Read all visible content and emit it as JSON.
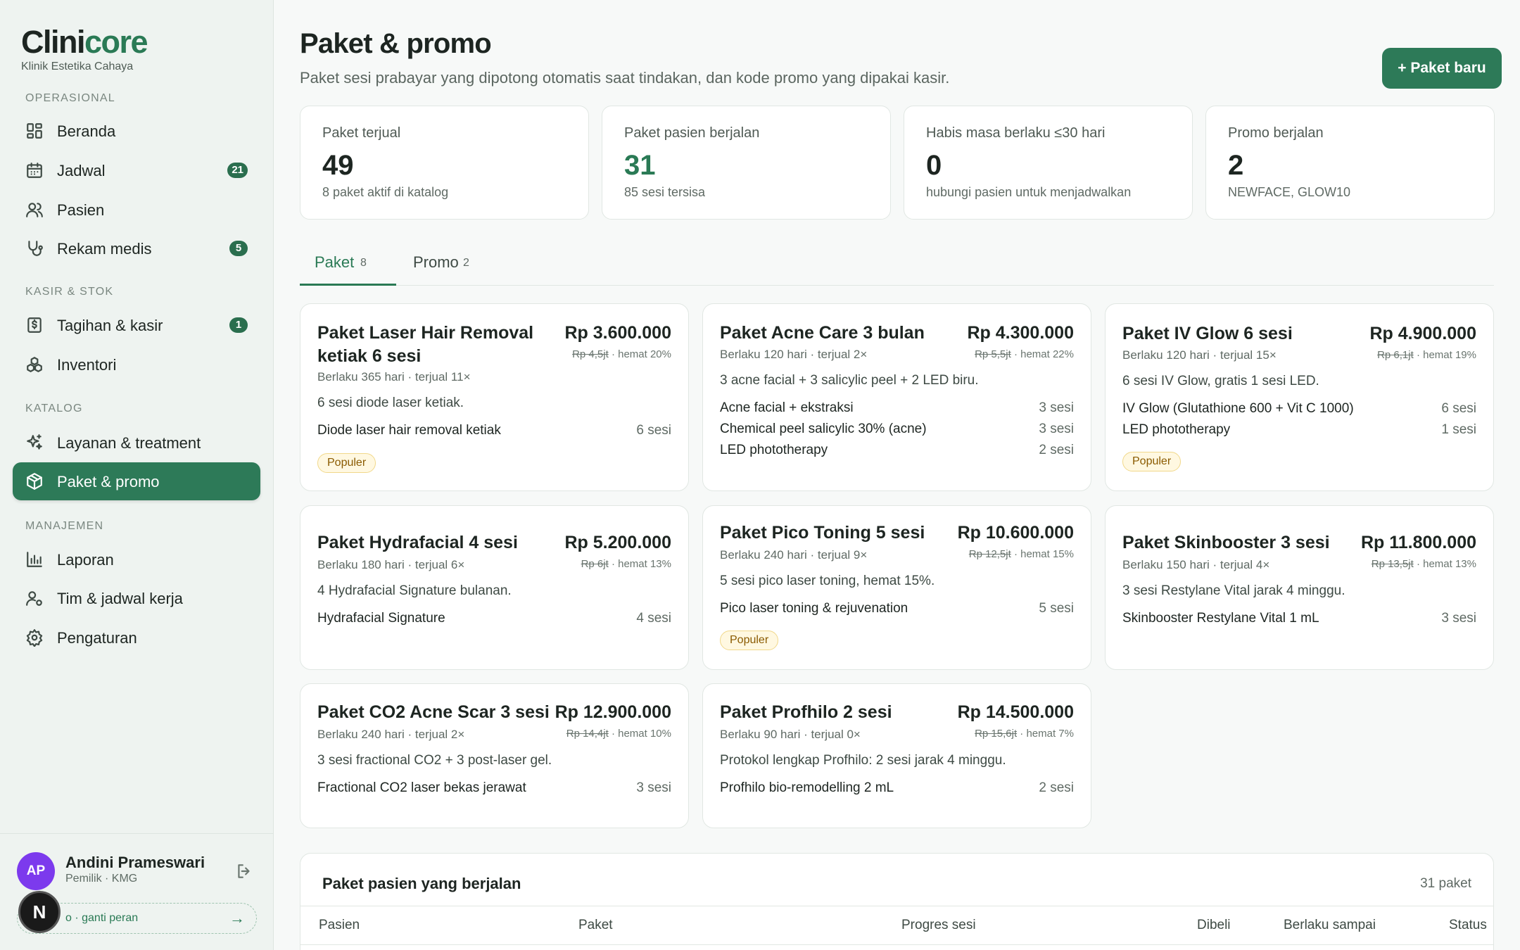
{
  "sidebar": {
    "brand_a": "Clini",
    "brand_b": "core",
    "clinic": "Klinik Estetika Cahaya",
    "sections": {
      "operasional": "OPERASIONAL",
      "kasir": "KASIR & STOK",
      "katalog": "KATALOG",
      "manajemen": "MANAJEMEN"
    },
    "items": [
      {
        "label": "Beranda",
        "badge": ""
      },
      {
        "label": "Jadwal",
        "badge": "21"
      },
      {
        "label": "Pasien",
        "badge": ""
      },
      {
        "label": "Rekam medis",
        "badge": "5"
      },
      {
        "label": "Tagihan & kasir",
        "badge": "1"
      },
      {
        "label": "Inventori",
        "badge": ""
      },
      {
        "label": "Layanan & treatment",
        "badge": ""
      },
      {
        "label": "Paket & promo",
        "badge": ""
      },
      {
        "label": "Laporan",
        "badge": ""
      },
      {
        "label": "Tim & jadwal kerja",
        "badge": ""
      },
      {
        "label": "Pengaturan",
        "badge": ""
      }
    ],
    "user": {
      "initials": "AP",
      "name": "Andini Prameswari",
      "role": "Pemilik · KMG",
      "demo_label": "o · ganti peran",
      "demo_arrow": "→"
    },
    "floating_initial": "N"
  },
  "header": {
    "title": "Paket & promo",
    "subtitle": "Paket sesi prabayar yang dipotong otomatis saat tindakan, dan kode promo yang dipakai kasir.",
    "new_button": "+ Paket baru"
  },
  "stats": [
    {
      "label": "Paket terjual",
      "value": "49",
      "sub": "8 paket aktif di katalog"
    },
    {
      "label": "Paket pasien berjalan",
      "value": "31",
      "sub": "85 sesi tersisa"
    },
    {
      "label": "Habis masa berlaku ≤30 hari",
      "value": "0",
      "sub": "hubungi pasien untuk menjadwalkan"
    },
    {
      "label": "Promo berjalan",
      "value": "2",
      "sub": "NEWFACE, GLOW10"
    }
  ],
  "tabs": [
    {
      "label": "Paket",
      "count": "8"
    },
    {
      "label": "Promo",
      "count": "2"
    }
  ],
  "packages": [
    {
      "name": "Paket Laser Hair Removal ketiak 6 sesi",
      "meta": "Berlaku 365 hari · terjual 11×",
      "price": "Rp 3.600.000",
      "old_price": "Rp 4,5jt",
      "saving": " · hemat 20%",
      "desc": "6 sesi diode laser ketiak.",
      "items": [
        {
          "name": "Diode laser hair removal ketiak",
          "qty": "6 sesi"
        }
      ],
      "tag": "Populer"
    },
    {
      "name": "Paket Acne Care 3 bulan",
      "meta": "Berlaku 120 hari · terjual 2×",
      "price": "Rp 4.300.000",
      "old_price": "Rp 5,5jt",
      "saving": " · hemat 22%",
      "desc": "3 acne facial + 3 salicylic peel + 2 LED biru.",
      "items": [
        {
          "name": "Acne facial + ekstraksi",
          "qty": "3 sesi"
        },
        {
          "name": "Chemical peel salicylic 30% (acne)",
          "qty": "3 sesi"
        },
        {
          "name": "LED phototherapy",
          "qty": "2 sesi"
        }
      ],
      "tag": ""
    },
    {
      "name": "Paket IV Glow 6 sesi",
      "meta": "Berlaku 120 hari · terjual 15×",
      "price": "Rp 4.900.000",
      "old_price": "Rp 6,1jt",
      "saving": " · hemat 19%",
      "desc": "6 sesi IV Glow, gratis 1 sesi LED.",
      "items": [
        {
          "name": "IV Glow (Glutathione 600 + Vit C 1000)",
          "qty": "6 sesi"
        },
        {
          "name": "LED phototherapy",
          "qty": "1 sesi"
        }
      ],
      "tag": "Populer"
    },
    {
      "name": "Paket Hydrafacial 4 sesi",
      "meta": "Berlaku 180 hari · terjual 6×",
      "price": "Rp 5.200.000",
      "old_price": "Rp 6jt",
      "saving": " · hemat 13%",
      "desc": "4 Hydrafacial Signature bulanan.",
      "items": [
        {
          "name": "Hydrafacial Signature",
          "qty": "4 sesi"
        }
      ],
      "tag": ""
    },
    {
      "name": "Paket Pico Toning 5 sesi",
      "meta": "Berlaku 240 hari · terjual 9×",
      "price": "Rp 10.600.000",
      "old_price": "Rp 12,5jt",
      "saving": " · hemat 15%",
      "desc": "5 sesi pico laser toning, hemat 15%.",
      "items": [
        {
          "name": "Pico laser toning & rejuvenation",
          "qty": "5 sesi"
        }
      ],
      "tag": "Populer"
    },
    {
      "name": "Paket Skinbooster 3 sesi",
      "meta": "Berlaku 150 hari · terjual 4×",
      "price": "Rp 11.800.000",
      "old_price": "Rp 13,5jt",
      "saving": " · hemat 13%",
      "desc": "3 sesi Restylane Vital jarak 4 minggu.",
      "items": [
        {
          "name": "Skinbooster Restylane Vital 1 mL",
          "qty": "3 sesi"
        }
      ],
      "tag": ""
    },
    {
      "name": "Paket CO2 Acne Scar 3 sesi",
      "meta": "Berlaku 240 hari · terjual 2×",
      "price": "Rp 12.900.000",
      "old_price": "Rp 14,4jt",
      "saving": " · hemat 10%",
      "desc": "3 sesi fractional CO2 + 3 post-laser gel.",
      "items": [
        {
          "name": "Fractional CO2 laser bekas jerawat",
          "qty": "3 sesi"
        }
      ],
      "tag": ""
    },
    {
      "name": "Paket Profhilo 2 sesi",
      "meta": "Berlaku 90 hari · terjual 0×",
      "price": "Rp 14.500.000",
      "old_price": "Rp 15,6jt",
      "saving": " · hemat 7%",
      "desc": "Protokol lengkap Profhilo: 2 sesi jarak 4 minggu.",
      "items": [
        {
          "name": "Profhilo bio-remodelling 2 mL",
          "qty": "2 sesi"
        }
      ],
      "tag": ""
    }
  ],
  "running": {
    "title": "Paket pasien yang berjalan",
    "count": "31 paket",
    "columns": [
      "Pasien",
      "Paket",
      "Progres sesi",
      "Dibeli",
      "Berlaku sampai",
      "Status"
    ]
  }
}
